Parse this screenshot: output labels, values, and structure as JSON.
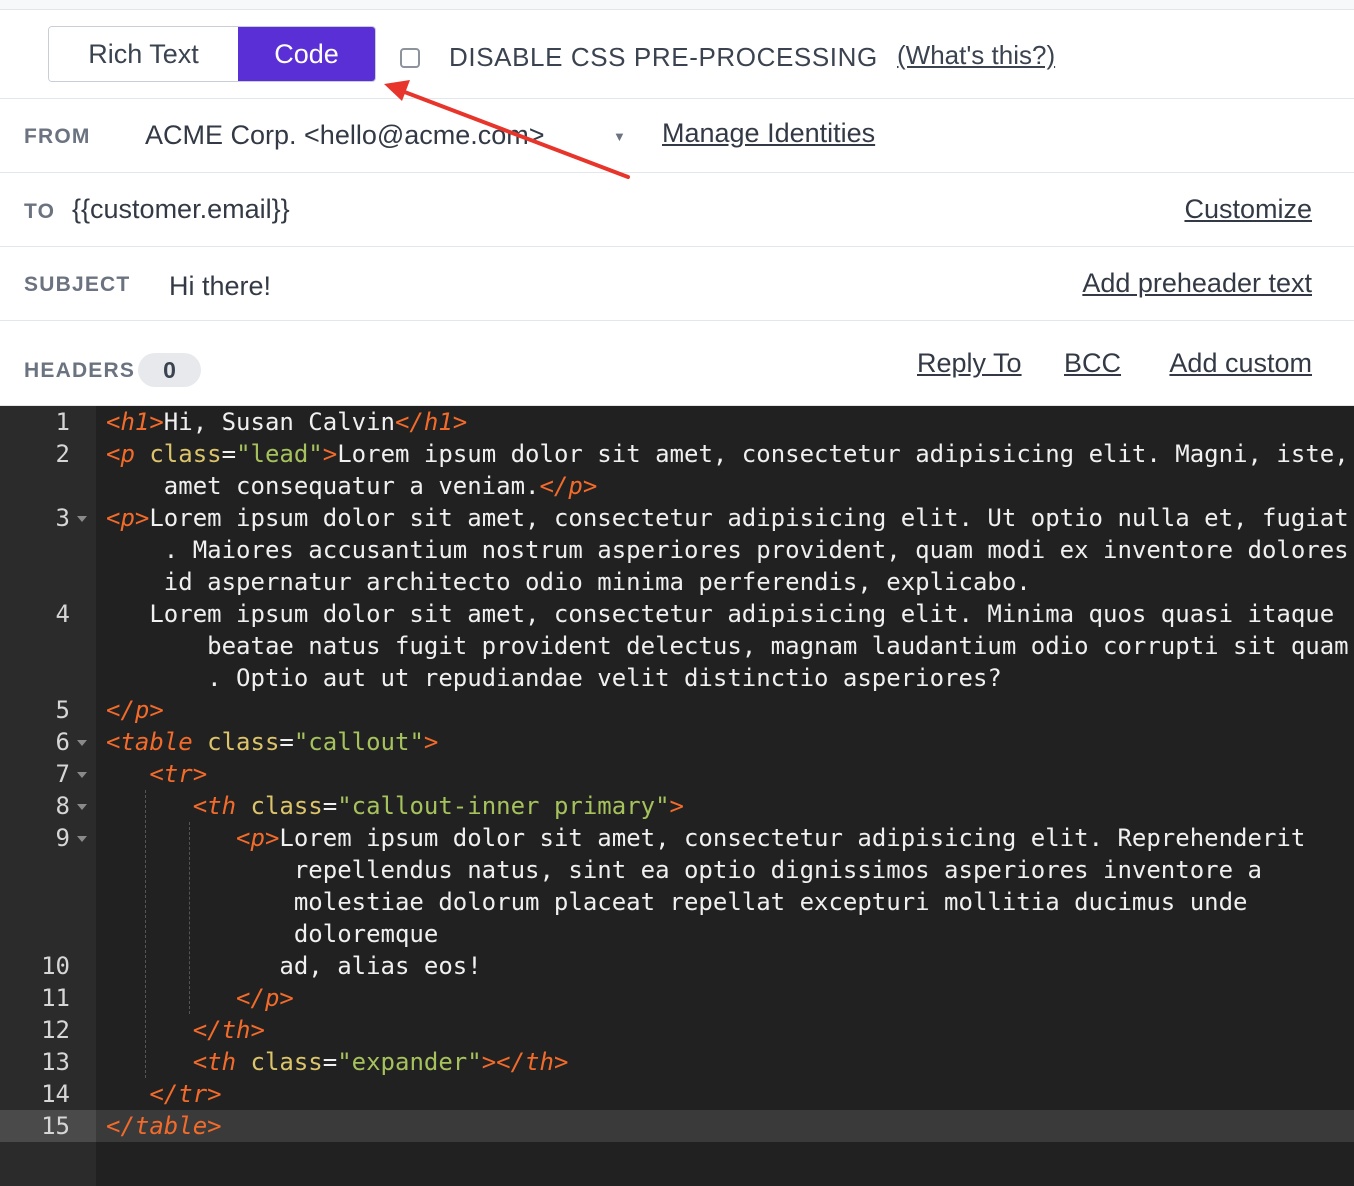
{
  "toolbar": {
    "rich_text_label": "Rich Text",
    "code_label": "Code",
    "disable_css_label": "DISABLE CSS PRE-PROCESSING",
    "whats_this_label": "(What's this?)"
  },
  "from": {
    "label": "FROM",
    "value": "ACME Corp. <hello@acme.com>",
    "manage_link": "Manage Identities"
  },
  "to": {
    "label": "TO",
    "value": "{{customer.email}}",
    "customize_link": "Customize"
  },
  "subject": {
    "label": "SUBJECT",
    "value": "Hi there!",
    "preheader_link": "Add preheader text"
  },
  "headers": {
    "label": "HEADERS",
    "count": "0",
    "reply_to_link": "Reply To",
    "bcc_link": "BCC",
    "add_custom_link": "Add custom"
  },
  "editor": {
    "active_line": "15",
    "line_numbers": [
      "1",
      "2",
      "3",
      "4",
      "5",
      "6",
      "7",
      "8",
      "9",
      "10",
      "11",
      "12",
      "13",
      "14",
      "15"
    ],
    "lines": [
      [
        [
          "tag",
          "<h1>"
        ],
        [
          "text",
          "Hi, Susan Calvin"
        ],
        [
          "tag",
          "</h1>"
        ]
      ],
      [
        [
          "tag",
          "<p "
        ],
        [
          "attr",
          "class"
        ],
        [
          "text",
          "="
        ],
        [
          "str",
          "\"lead\""
        ],
        [
          "tag",
          ">"
        ],
        [
          "text",
          "Lorem ipsum dolor sit amet, consectetur adipisicing elit. Magni, iste,"
        ]
      ],
      [
        [
          "text",
          "    amet consequatur a veniam."
        ],
        [
          "tag",
          "</p>"
        ]
      ],
      [
        [
          "tag",
          "<p>"
        ],
        [
          "text",
          "Lorem ipsum dolor sit amet, consectetur adipisicing elit. Ut optio nulla et, fugiat"
        ]
      ],
      [
        [
          "text",
          "    . Maiores accusantium nostrum asperiores provident, quam modi ex inventore dolores"
        ]
      ],
      [
        [
          "text",
          "    id aspernatur architecto odio minima perferendis, explicabo."
        ]
      ],
      [
        [
          "text",
          "   Lorem ipsum dolor sit amet, consectetur adipisicing elit. Minima quos quasi itaque"
        ]
      ],
      [
        [
          "text",
          "       beatae natus fugit provident delectus, magnam laudantium odio corrupti sit quam"
        ]
      ],
      [
        [
          "text",
          "       . Optio aut ut repudiandae velit distinctio asperiores?"
        ]
      ],
      [
        [
          "tag",
          "</p>"
        ]
      ],
      [
        [
          "tag",
          "<table "
        ],
        [
          "attr",
          "class"
        ],
        [
          "text",
          "="
        ],
        [
          "str",
          "\"callout\""
        ],
        [
          "tag",
          ">"
        ]
      ],
      [
        [
          "text",
          "   "
        ],
        [
          "tag",
          "<tr>"
        ]
      ],
      [
        [
          "text",
          "      "
        ],
        [
          "tag",
          "<th "
        ],
        [
          "attr",
          "class"
        ],
        [
          "text",
          "="
        ],
        [
          "str",
          "\"callout-inner primary\""
        ],
        [
          "tag",
          ">"
        ]
      ],
      [
        [
          "text",
          "         "
        ],
        [
          "tag",
          "<p>"
        ],
        [
          "text",
          "Lorem ipsum dolor sit amet, consectetur adipisicing elit. Reprehenderit"
        ]
      ],
      [
        [
          "text",
          "             repellendus natus, sint ea optio dignissimos asperiores inventore a"
        ]
      ],
      [
        [
          "text",
          "             molestiae dolorum placeat repellat excepturi mollitia ducimus unde"
        ]
      ],
      [
        [
          "text",
          "             doloremque"
        ]
      ],
      [
        [
          "text",
          "            ad, alias eos!"
        ]
      ],
      [
        [
          "text",
          "         "
        ],
        [
          "tag",
          "</p>"
        ]
      ],
      [
        [
          "text",
          "      "
        ],
        [
          "tag",
          "</th>"
        ]
      ],
      [
        [
          "text",
          "      "
        ],
        [
          "tag",
          "<th "
        ],
        [
          "attr",
          "class"
        ],
        [
          "text",
          "="
        ],
        [
          "str",
          "\"expander\""
        ],
        [
          "tag",
          "></th>"
        ]
      ],
      [
        [
          "text",
          "   "
        ],
        [
          "tag",
          "</tr>"
        ]
      ],
      [
        [
          "tag",
          "</table>"
        ]
      ]
    ]
  },
  "colors": {
    "accent": "#5b2fd6",
    "editor_bg": "#212121",
    "tag": "#f26b2a",
    "attr": "#dcc46a",
    "string": "#a5c25c",
    "annotation_arrow": "#e8352b"
  }
}
